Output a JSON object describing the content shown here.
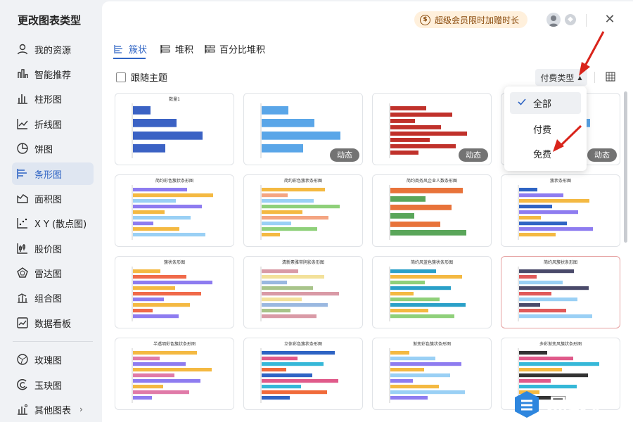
{
  "dialog": {
    "title": "更改图表类型"
  },
  "sidebar": {
    "items": [
      {
        "label": "我的资源",
        "icon": "user-icon"
      },
      {
        "label": "智能推荐",
        "icon": "recommend-icon"
      },
      {
        "label": "柱形图",
        "icon": "column-chart-icon"
      },
      {
        "label": "折线图",
        "icon": "line-chart-icon"
      },
      {
        "label": "饼图",
        "icon": "pie-chart-icon"
      },
      {
        "label": "条形图",
        "icon": "bar-chart-icon"
      },
      {
        "label": "面积图",
        "icon": "area-chart-icon"
      },
      {
        "label": "X Y (散点图)",
        "icon": "scatter-chart-icon"
      },
      {
        "label": "股价图",
        "icon": "stock-chart-icon"
      },
      {
        "label": "雷达图",
        "icon": "radar-chart-icon"
      },
      {
        "label": "组合图",
        "icon": "combo-chart-icon"
      },
      {
        "label": "数据看板",
        "icon": "dashboard-icon"
      },
      {
        "label": "玫瑰图",
        "icon": "rose-chart-icon"
      },
      {
        "label": "玉玦图",
        "icon": "jade-chart-icon"
      },
      {
        "label": "其他图表",
        "icon": "other-chart-icon"
      }
    ],
    "active_index": 5
  },
  "header": {
    "promo": "超级会员限时加赠时长",
    "promo_coin": "$"
  },
  "tabs": [
    {
      "label": "簇状",
      "active": true
    },
    {
      "label": "堆积",
      "active": false
    },
    {
      "label": "百分比堆积",
      "active": false
    }
  ],
  "toolbar": {
    "follow_theme": "跟随主题",
    "pay_type": "付费类型"
  },
  "dropdown": {
    "items": [
      "全部",
      "付费",
      "免费"
    ],
    "selected": "全部"
  },
  "cards": {
    "dynamic_label": "动态",
    "titles": [
      "数量1",
      "",
      "",
      "",
      "简约彩色簇状条形图",
      "简约彩色簇状条形图",
      "简约商务风企业人数条形图",
      "簇状条形图",
      "簇状条形图",
      "清新素雅带阴影条形图",
      "简约风蓝色簇状条形图",
      "简约风簇状条形图",
      "半透明彩色簇状条形图",
      "立体彩色簇状条形图",
      "渐变彩色簇状条形图",
      "多彩渐变风簇状条形图"
    ]
  },
  "watermark": {
    "text": "易软汇"
  },
  "colors": {
    "accent": "#2f64c4",
    "promo_bg": "#fff0dc",
    "arrow": "#d9241b",
    "dynamic_badge": "#737373"
  }
}
